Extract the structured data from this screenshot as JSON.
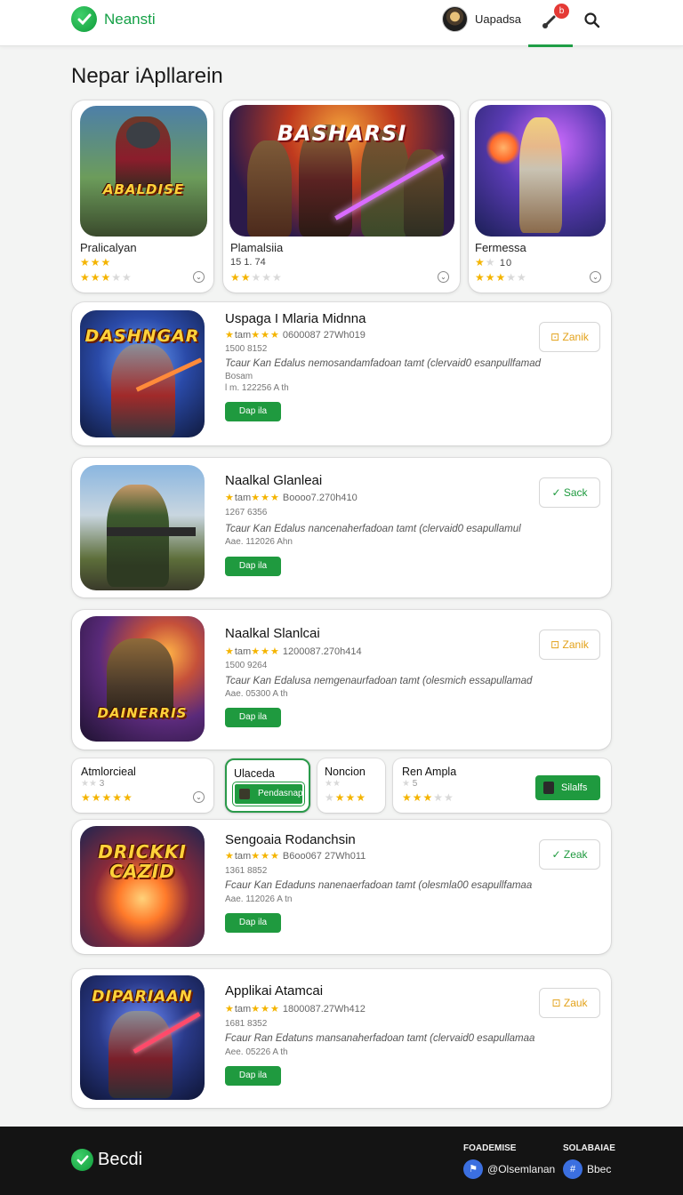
{
  "header": {
    "brand": "Neansti",
    "user_name": "Uapadsa",
    "notification_count": "b"
  },
  "page_title": "Nepar iApllarein",
  "featured": [
    {
      "name": "Pralicalyan",
      "meta": "",
      "art_text": "ABALDISE",
      "rating": 3,
      "icon": "chevron-down-icon"
    },
    {
      "name": "Plamalsiia",
      "meta": "15 1. 74",
      "art_text": "BASHARSI",
      "rating": 2,
      "icon": "chevron-down-icon"
    },
    {
      "name": "Fermessa",
      "meta": "10",
      "art_text": "",
      "rating": 3,
      "icon": "chevron-down-icon"
    }
  ],
  "apps": [
    {
      "title": "Uspaga I Mlaria Midnna",
      "rating_label": "tam",
      "rating_value": "0600087 27Wh019",
      "size": "1500 8152",
      "description": "Tcaur Kan Edalus nemosandamfadoan tamt (clervaid0 esanpullfamad",
      "extra": "Bosam",
      "extra2": "l m. 122256 A th",
      "get_label": "Dap ila",
      "side_label": "Zanik",
      "side_icon": "bookmark-icon",
      "art_text": "DASHNGAR"
    },
    {
      "title": "Naalkal Glanleai",
      "rating_label": "tam",
      "rating_value": "Boooo7.270h410",
      "size": "1267 6356",
      "description": "Tcaur Kan Edalus nancenaherfadoan tamt (clervaid0 esapullamul",
      "extra": "",
      "extra2": "Aae. 112026 Ahn",
      "get_label": "Dap ila",
      "side_label": "Sack",
      "side_icon": "check-icon",
      "art_text": ""
    },
    {
      "title": "Naalkal Slanlcai",
      "rating_label": "tam",
      "rating_value": "1200087.270h414",
      "size": "1500 9264",
      "description": "Tcaur Kan Edalusa nemgenaurfadoan tamt (olesmich essapullamad",
      "extra": "",
      "extra2": "Aae. 05300 A th",
      "get_label": "Dap ila",
      "side_label": "Zanik",
      "side_icon": "bookmark-icon",
      "art_text": "DAINERRIS"
    },
    {
      "title": "Sengoaia Rodanchsin",
      "rating_label": "tam",
      "rating_value": "B6oo067 27Wh011",
      "size": "1361 8852",
      "description": "Fcaur Kan Edaduns nanenaerfadoan tamt (olesmla00 esapullfamaa",
      "extra": "",
      "extra2": "Aae. 112026 A tn",
      "get_label": "Dap ila",
      "side_label": "Zeak",
      "side_icon": "check-icon",
      "art_text": "DRICKKI CAZID"
    },
    {
      "title": "Applikai Atamcai",
      "rating_label": "tam",
      "rating_value": "1800087.27Wh412",
      "size": "1681 8352",
      "description": "Fcaur Ran Edatuns mansanaherfadoan tamt (clervaid0 esapullamaa",
      "extra": "",
      "extra2": "Aee. 05226 A th",
      "get_label": "Dap ila",
      "side_label": "Zauk",
      "side_icon": "bookmark-icon",
      "art_text": "DIPARIAAN"
    }
  ],
  "mini_cards": [
    {
      "title": "Atmlorcieal",
      "sub": "3",
      "rating": 5
    },
    {
      "title": "Ulaceda",
      "button": "Pendasnap"
    },
    {
      "title": "Noncion",
      "sub": "",
      "rating": 3
    },
    {
      "title": "Ren Ampla",
      "sub": "5",
      "rating": 3,
      "button": "Silalfs"
    }
  ],
  "footer": {
    "brand": "Becdi",
    "col1_title": "FOADEMISE",
    "col1_link": "Olsemlanan",
    "col2_title": "SOLABAIAE",
    "col2_link": "Bbec"
  },
  "colors": {
    "accent_green": "#1f9a3f",
    "star_yellow": "#f4b400",
    "footer_bg": "#141414"
  }
}
